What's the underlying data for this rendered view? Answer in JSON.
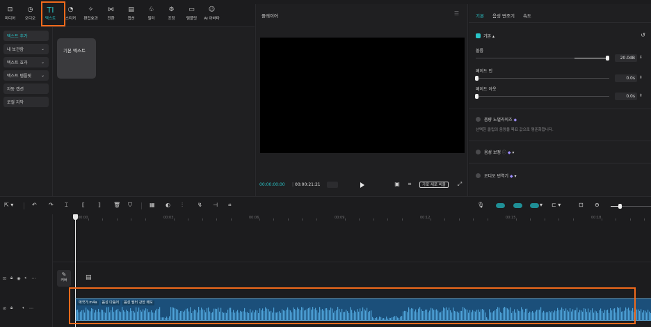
{
  "toolbar": {
    "items": [
      {
        "label": "미디어",
        "icon": "media-icon"
      },
      {
        "label": "오디오",
        "icon": "audio-icon"
      },
      {
        "label": "텍스트",
        "icon": "text-icon",
        "active": true
      },
      {
        "label": "스티커",
        "icon": "sticker-icon"
      },
      {
        "label": "편집효과",
        "icon": "effects-icon"
      },
      {
        "label": "전환",
        "icon": "transition-icon"
      },
      {
        "label": "캡션",
        "icon": "caption-icon"
      },
      {
        "label": "필터",
        "icon": "filter-icon"
      },
      {
        "label": "조정",
        "icon": "adjust-icon"
      },
      {
        "label": "템플릿",
        "icon": "template-icon"
      },
      {
        "label": "AI 아바타",
        "icon": "ai-avatar-icon"
      }
    ]
  },
  "left_panel": {
    "sidebar": [
      {
        "label": "텍스트 추가",
        "active": true,
        "chevron": false
      },
      {
        "label": "내 보관함",
        "active": false,
        "chevron": true
      },
      {
        "label": "텍스트 효과",
        "active": false,
        "chevron": true
      },
      {
        "label": "텍스트 템플릿",
        "active": false,
        "chevron": true
      },
      {
        "label": "자동 캡션",
        "active": false,
        "chevron": false
      },
      {
        "label": "로컬 자막",
        "active": false,
        "chevron": false
      }
    ],
    "card_label": "기본 텍스트"
  },
  "player": {
    "title": "플레이어",
    "current_time": "00:00:00:00",
    "total_time": "00:00:21:21",
    "ratio_label": "가로 세로 비율"
  },
  "right_panel": {
    "tabs": [
      {
        "label": "기본",
        "active": true
      },
      {
        "label": "음성 변조기",
        "active": false
      },
      {
        "label": "속도",
        "active": false
      }
    ],
    "section_title": "기본",
    "volume": {
      "label": "볼륨",
      "value": "20.0dB",
      "level": 0.98
    },
    "fade_in": {
      "label": "페이드 인",
      "value": "0.0s",
      "level": 0
    },
    "fade_out": {
      "label": "페이드 아웃",
      "value": "0.0s",
      "level": 0
    },
    "normalize": {
      "label": "음량 노멀라이즈",
      "hint": "선택한 클립의 음량을 목표 값으로 평준화합니다."
    },
    "enhance": {
      "label": "음성 보정"
    },
    "translate": {
      "label": "오디오 번역기"
    }
  },
  "timeline": {
    "ruler": [
      "00:00",
      "00:03",
      "00:06",
      "00:09",
      "00:12",
      "00:15",
      "00:18"
    ],
    "cover_label": "커버",
    "clip": {
      "name": "애국가.m4a",
      "tags": [
        "음성 다듬어",
        "음성 필터 강한 메모"
      ]
    }
  },
  "colors": {
    "accent": "#29c6c9",
    "highlight": "#f26a1b",
    "clip": "#1b4f7a"
  }
}
